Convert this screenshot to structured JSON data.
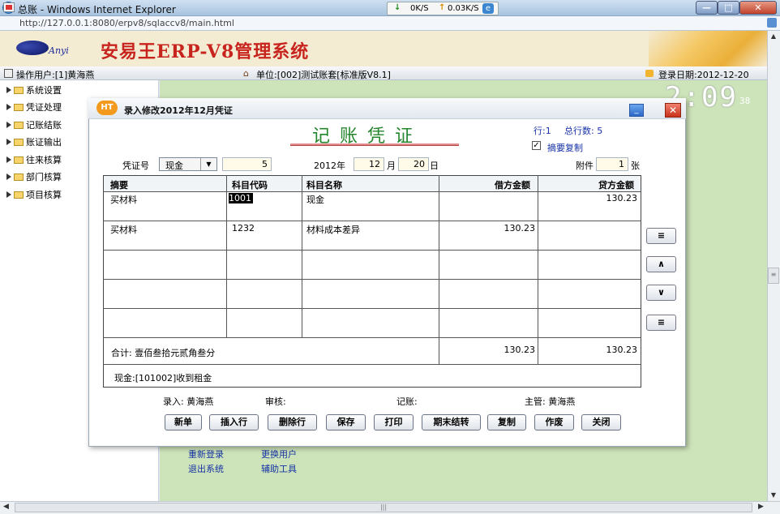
{
  "window": {
    "title": "总账 - Windows Internet Explorer",
    "url": "http://127.0.0.1:8080/erpv8/sqlaccv8/main.html",
    "speed_down": "0K/S",
    "speed_up": "0.03K/S"
  },
  "header": {
    "logo_text": "Anyi",
    "app_title": "安易王ERP-V8管理系统",
    "operator": "操作用户:[1]黄海燕",
    "unit": "单位:[002]测试账套[标准版V8.1]",
    "login_date": "登录日期:2012-12-20"
  },
  "sidebar": {
    "items": [
      {
        "label": "系统设置"
      },
      {
        "label": "凭证处理"
      },
      {
        "label": "记账结账"
      },
      {
        "label": "账证输出"
      },
      {
        "label": "往来核算"
      },
      {
        "label": "部门核算"
      },
      {
        "label": "项目核算"
      }
    ]
  },
  "clock": {
    "time": "2:09",
    "seconds": "38"
  },
  "bottom_links": {
    "relogin": "重新登录",
    "change_user": "更换用户",
    "exit": "退出系统",
    "tools": "辅助工具"
  },
  "dialog": {
    "icon_text": "HT",
    "title": "录入修改2012年12月凭证",
    "voucher_title": "记账凭证",
    "row_info": "行:1",
    "total_rows": "总行数: 5",
    "copy_summary_label": "摘要复制",
    "copy_summary_checked": "✓",
    "voucher_no_label": "凭证号",
    "voucher_type": "现金",
    "voucher_number": "5",
    "year_label": "2012年",
    "month": "12",
    "month_label": "月",
    "day": "20",
    "day_label": "日",
    "attach_label": "附件",
    "attach_count": "1",
    "attach_unit": "张",
    "columns": {
      "summary": "摘要",
      "code": "科目代码",
      "name": "科目名称",
      "debit": "借方金额",
      "credit": "贷方金额"
    },
    "rows": [
      {
        "summary": "买材料",
        "code": "1001",
        "name": "现金",
        "debit": "",
        "credit": "130.23"
      },
      {
        "summary": "买材料",
        "code": "1232",
        "name": "材料成本差异",
        "debit": "130.23",
        "credit": ""
      }
    ],
    "total_label": "合计: 壹佰叁拾元贰角叁分",
    "total_debit": "130.23",
    "total_credit": "130.23",
    "balance_info": "现金:[101002]收到租金",
    "side_buttons": {
      "top": "≡",
      "up": "∧",
      "down": "∨",
      "bottom": "≡"
    },
    "signatures": {
      "entry": "录入: 黄海燕",
      "audit": "审核:",
      "posting": "记账:",
      "supervisor": "主管: 黄海燕"
    },
    "actions": {
      "new": "新单",
      "insert_row": "插入行",
      "delete_row": "删除行",
      "save": "保存",
      "print": "打印",
      "period_end": "期末结转",
      "copy": "复制",
      "void": "作废",
      "close": "关闭"
    }
  }
}
